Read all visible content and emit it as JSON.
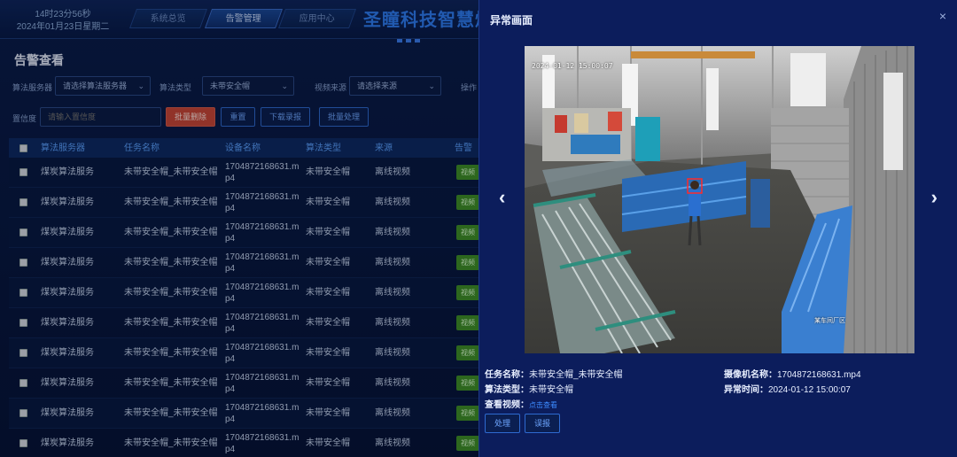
{
  "header": {
    "time": "14时23分56秒",
    "date": "2024年01月23日星期二",
    "tabs": [
      "系统总览",
      "告警管理",
      "应用中心"
    ],
    "active_tab": 1,
    "brand": "圣瞳科技智慧煤"
  },
  "page": {
    "title": "告警查看"
  },
  "filters": {
    "server_label": "算法服务器",
    "server_value": "请选择算法服务器",
    "algo_label": "算法类型",
    "algo_value": "未带安全帽",
    "video_label": "视频来源",
    "video_value": "请选择来源",
    "ops_label": "操作",
    "conf_label": "置信度",
    "conf_placeholder": "请输入置信度",
    "batch_delete": "批量删除",
    "reset": "重置",
    "download": "下载录报",
    "batch_process": "批量处理"
  },
  "table": {
    "columns": [
      "算法服务器",
      "任务名称",
      "设备名称",
      "算法类型",
      "来源",
      "告警"
    ],
    "rows": [
      {
        "server": "煤炭算法服务",
        "task": "未带安全帽_未带安全帽",
        "device_l1": "1704872168631.m",
        "device_l2": "p4",
        "algo": "未带安全帽",
        "source": "离线视频",
        "action": "视频"
      },
      {
        "server": "煤炭算法服务",
        "task": "未带安全帽_未带安全帽",
        "device_l1": "1704872168631.m",
        "device_l2": "p4",
        "algo": "未带安全帽",
        "source": "离线视频",
        "action": "视频"
      },
      {
        "server": "煤炭算法服务",
        "task": "未带安全帽_未带安全帽",
        "device_l1": "1704872168631.m",
        "device_l2": "p4",
        "algo": "未带安全帽",
        "source": "离线视频",
        "action": "视频"
      },
      {
        "server": "煤炭算法服务",
        "task": "未带安全帽_未带安全帽",
        "device_l1": "1704872168631.m",
        "device_l2": "p4",
        "algo": "未带安全帽",
        "source": "离线视频",
        "action": "视频"
      },
      {
        "server": "煤炭算法服务",
        "task": "未带安全帽_未带安全帽",
        "device_l1": "1704872168631.m",
        "device_l2": "p4",
        "algo": "未带安全帽",
        "source": "离线视频",
        "action": "视频"
      },
      {
        "server": "煤炭算法服务",
        "task": "未带安全帽_未带安全帽",
        "device_l1": "1704872168631.m",
        "device_l2": "p4",
        "algo": "未带安全帽",
        "source": "离线视频",
        "action": "视频"
      },
      {
        "server": "煤炭算法服务",
        "task": "未带安全帽_未带安全帽",
        "device_l1": "1704872168631.m",
        "device_l2": "p4",
        "algo": "未带安全帽",
        "source": "离线视频",
        "action": "视频"
      },
      {
        "server": "煤炭算法服务",
        "task": "未带安全帽_未带安全帽",
        "device_l1": "1704872168631.m",
        "device_l2": "p4",
        "algo": "未带安全帽",
        "source": "离线视频",
        "action": "视频"
      },
      {
        "server": "煤炭算法服务",
        "task": "未带安全帽_未带安全帽",
        "device_l1": "1704872168631.m",
        "device_l2": "p4",
        "algo": "未带安全帽",
        "source": "离线视频",
        "action": "视频"
      },
      {
        "server": "煤炭算法服务",
        "task": "未带安全帽_未带安全帽",
        "device_l1": "1704872168631.m",
        "device_l2": "p4",
        "algo": "未带安全帽",
        "source": "离线视频",
        "action": "视频"
      }
    ]
  },
  "modal": {
    "title": "异常画面",
    "close": "×",
    "prev": "‹",
    "next": "›",
    "osd_timestamp": "2024-01-12 15:00:07",
    "camera_watermark": "某车间厂区",
    "task_label": "任务名称：",
    "task_value": "未带安全帽_未带安全帽",
    "camera_label": "摄像机名称：",
    "camera_value": "1704872168631.mp4",
    "algo_label": "算法类型：",
    "algo_value": "未带安全帽",
    "time_label": "异常时间：",
    "time_value": "2024-01-12 15:00:07",
    "video_label": "查看视频：",
    "video_link": "点击查看",
    "process_btn": "处理",
    "report_btn": "误报"
  },
  "colors": {
    "accent": "#2f7df4",
    "danger": "#c9473a",
    "ok": "#3f8f2a",
    "modal_bg": "#0c1d5c"
  }
}
